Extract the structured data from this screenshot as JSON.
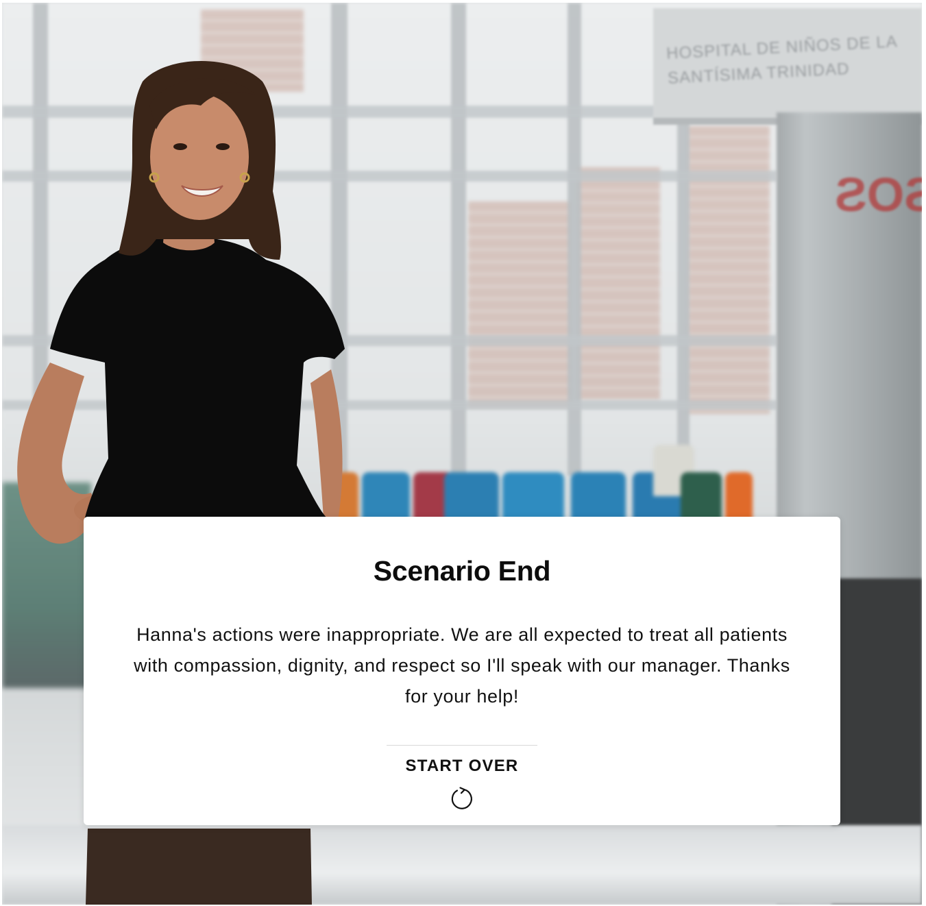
{
  "background": {
    "scene": "hospital-waiting-area",
    "sign_text": "HOSPITAL DE NIÑOS DE LA SANTÍSIMA TRINIDAD",
    "kiosk_text": "SOS"
  },
  "character": {
    "name": "Hanna"
  },
  "dialog": {
    "title": "Scenario End",
    "message": "Hanna's actions were inappropriate. We are all expected to treat all patients with compassion, dignity, and respect so I'll speak with our manager. Thanks for your help!",
    "start_over_label": "START OVER",
    "start_over_icon": "restart-icon"
  },
  "colors": {
    "card_background": "#ffffff",
    "text": "#111111"
  }
}
